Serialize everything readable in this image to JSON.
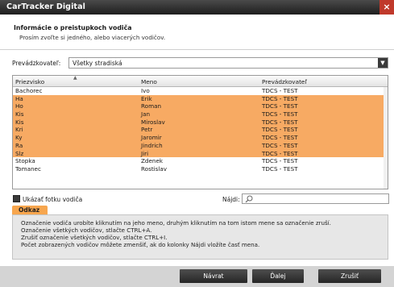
{
  "window": {
    "title": "CarTracker Digital",
    "close_glyph": "×"
  },
  "header": {
    "title": "Informácie o preistupkoch vodiča",
    "subtitle": "Prosím zvoľte si jedného, alebo viacerých vodičov."
  },
  "operator": {
    "label": "Prevádzkovateľ:",
    "value": "Všetky stradiská",
    "arrow_icon": "chevron-down-icon"
  },
  "table": {
    "columns": [
      "Priezvisko",
      "Meno",
      "Prevádzkovateľ"
    ],
    "rows": [
      {
        "last": "Bachorec",
        "first": "Ivo",
        "operator": "TDCS - TEST",
        "selected": false
      },
      {
        "last": "Ha",
        "first": "Erik",
        "operator": "TDCS - TEST",
        "selected": true
      },
      {
        "last": "Ho",
        "first": "Roman",
        "operator": "TDCS - TEST",
        "selected": true
      },
      {
        "last": "Kis",
        "first": "Jan",
        "operator": "TDCS - TEST",
        "selected": true
      },
      {
        "last": "Kis",
        "first": "Miroslav",
        "operator": "TDCS - TEST",
        "selected": true
      },
      {
        "last": "Kri",
        "first": "Petr",
        "operator": "TDCS - TEST",
        "selected": true
      },
      {
        "last": "Ky",
        "first": "Jaromir",
        "operator": "TDCS - TEST",
        "selected": true
      },
      {
        "last": "Ra",
        "first": "Jindrich",
        "operator": "TDCS - TEST",
        "selected": true
      },
      {
        "last": "Slz",
        "first": "Jiri",
        "operator": "TDCS - TEST",
        "selected": true
      },
      {
        "last": "Stopka",
        "first": "Zdenek",
        "operator": "TDCS - TEST",
        "selected": false
      },
      {
        "last": "Tomanec",
        "first": "Rostislav",
        "operator": "TDCS - TEST",
        "selected": false
      }
    ]
  },
  "photo": {
    "label": "Ukázať fotku vodiča",
    "checked": true
  },
  "search": {
    "label": "Nájdi:",
    "value": "",
    "icon": "search-icon"
  },
  "help": {
    "tab_label": "Odkaz",
    "lines": [
      "Označenie vodiča urobíte kliknutím na jeho meno, druhým kliknutím na tom istom mene sa označenie zruší.",
      "Označenie všetkých vodičov, stlačte CTRL+A.",
      "Zrušiť označenie všetkých vodičov, stlačte CTRL+I.",
      "Počet zobrazených vodičov môžete zmenšiť, ak do kolonky Nájdi vložíte časť mena."
    ]
  },
  "footer": {
    "back": "Návrat",
    "next": "Ďalej",
    "cancel": "Zrušiť"
  },
  "colors": {
    "selection": "#f7aa63",
    "accent_tab": "#f7a64e",
    "close": "#c0392b"
  }
}
